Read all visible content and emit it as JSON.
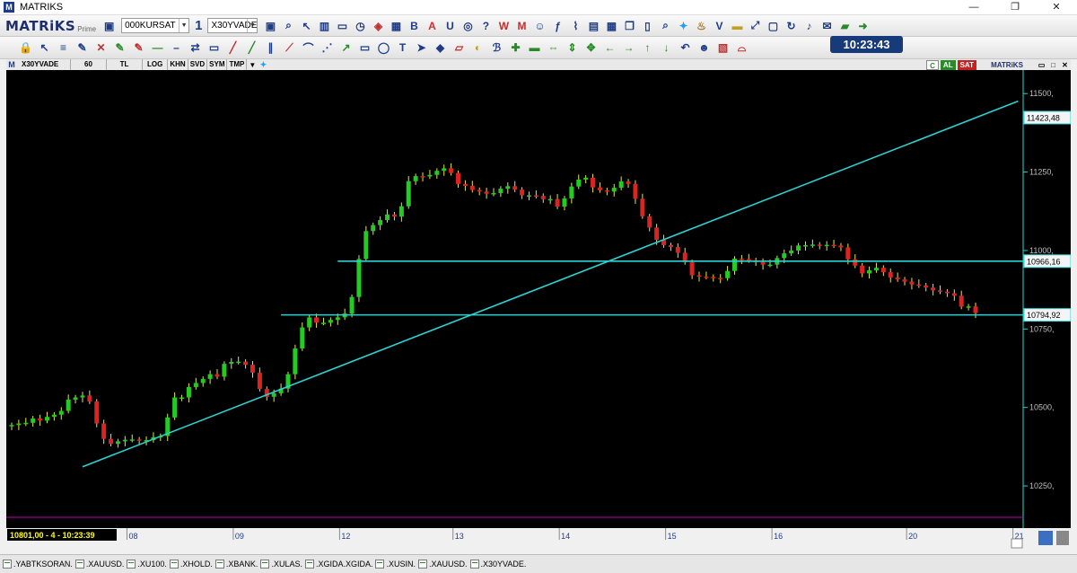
{
  "window": {
    "title": "MATRIKS",
    "minimize": "—",
    "maximize": "❐",
    "close": "✕"
  },
  "toolbar1": {
    "logo": "MATRiKS",
    "logo_sub": "Prime",
    "account_combo": "000KURSAT",
    "layout_number": "1",
    "symbol_combo": "X30YVADE",
    "icons": [
      "save-icon",
      "search-icon",
      "pointer-icon",
      "bar-chart-icon",
      "monitor-icon",
      "clock-icon",
      "layers-icon",
      "table-icon",
      "bold-b-icon",
      "font-color-a-icon",
      "underline-u-icon",
      "circle-tool-icon",
      "help-icon",
      "wp-icon",
      "m-icon",
      "people-icon",
      "fx-icon",
      "chart-line-icon",
      "grid-icon",
      "calendar-icon",
      "copy-icon",
      "doc-icon",
      "magnify-icon",
      "twitter-icon",
      "cup-icon",
      "v-icon",
      "folder-icon",
      "resize-icon",
      "window-icon",
      "refresh-icon",
      "bell-icon",
      "mail-icon",
      "chat-icon",
      "green-arrow-icon"
    ]
  },
  "clock": "10:23:43",
  "toolbar2": {
    "icons": [
      "lock-icon",
      "arrow-up-left-icon",
      "fibonacci-icon",
      "pencil-icon",
      "cross-icon",
      "pencil-green-icon",
      "pencil-red-icon",
      "minus-icon",
      "dash-icon",
      "arrows-lr-icon",
      "visual-icon",
      "pen-red-icon",
      "pen-green-icon",
      "channel-icon",
      "gann-icon",
      "arc-icon",
      "fan-icon",
      "trend-icon",
      "rect-icon",
      "ellipse-icon",
      "text-icon",
      "arrow-icon",
      "shapes-icon",
      "eraser-icon",
      "fill-icon",
      "brush-icon",
      "zoom-in-icon",
      "zoom-out-icon",
      "move-h-icon",
      "move-v-icon",
      "fit-icon",
      "left-arrow-icon",
      "right-arrow-icon",
      "up-arrow-icon",
      "down-arrow-icon",
      "undo-icon",
      "person-icon",
      "image-icon",
      "red-arc-icon"
    ]
  },
  "chart_header": {
    "symbol": "X30YVADE",
    "period": "60",
    "currency": "TL",
    "log": "LOG",
    "khn": "KHN",
    "svd": "SVD",
    "sym": "SYM",
    "tmp": "TMP",
    "c_tag": "C",
    "al_tag": "AL",
    "sat_tag": "SAT",
    "brand": "MATRiKS"
  },
  "status_readout": "10801,00 - 4 - 10:23:39",
  "chart_data": {
    "type": "candlestick",
    "title": "",
    "xlabel": "",
    "ylabel": "",
    "ylim": [
      10150,
      11575
    ],
    "y_ticks": [
      "11500,",
      "11250,",
      "11000,",
      "10750,",
      "10500,",
      "10250,"
    ],
    "y_tick_values": [
      11500,
      11250,
      11000,
      10750,
      10500,
      10250
    ],
    "x_ticks": [
      "08",
      "09",
      "12",
      "13",
      "14",
      "15",
      "16",
      "20",
      "21"
    ],
    "price_labels": [
      {
        "text": "11423,48",
        "value": 11423.48
      },
      {
        "text": "10966,16",
        "value": 10966.16
      },
      {
        "text": "10794,92",
        "value": 10794.92
      }
    ],
    "trend_line": {
      "from": {
        "bar": 10,
        "value": 10311
      },
      "to": {
        "bar": 142,
        "value": 11476
      }
    },
    "horizontal_lines": [
      {
        "value": 10794.92,
        "from_bar": 38
      },
      {
        "value": 10966.16,
        "from_bar": 46
      }
    ],
    "up_color": "#22cc22",
    "down_color": "#dd2222",
    "grid": false,
    "background": "#000000",
    "series_close": [
      10444,
      10449,
      10451,
      10465,
      10458,
      10470,
      10477,
      10489,
      10525,
      10532,
      10538,
      10519,
      10449,
      10400,
      10384,
      10392,
      10397,
      10398,
      10395,
      10396,
      10405,
      10409,
      10468,
      10532,
      10532,
      10565,
      10578,
      10591,
      10606,
      10598,
      10639,
      10645,
      10646,
      10636,
      10611,
      10559,
      10534,
      10545,
      10560,
      10606,
      10688,
      10755,
      10787,
      10770,
      10770,
      10779,
      10787,
      10799,
      10852,
      10973,
      11062,
      11081,
      11097,
      11115,
      11108,
      11141,
      11221,
      11237,
      11236,
      11241,
      11254,
      11262,
      11247,
      11212,
      11206,
      11193,
      11188,
      11181,
      11183,
      11197,
      11205,
      11194,
      11176,
      11176,
      11174,
      11164,
      11164,
      11140,
      11166,
      11204,
      11226,
      11232,
      11201,
      11192,
      11188,
      11200,
      11220,
      11212,
      11165,
      11109,
      11073,
      11034,
      11017,
      11011,
      10993,
      10963,
      10921,
      10917,
      10916,
      10913,
      10912,
      10935,
      10974,
      10973,
      10969,
      10963,
      10955,
      10955,
      10976,
      10991,
      11000,
      11016,
      11017,
      11019,
      11016,
      11018,
      11016,
      11010,
      10972,
      10952,
      10927,
      10937,
      10945,
      10931,
      10914,
      10908,
      10901,
      10892,
      10889,
      10882,
      10873,
      10869,
      10864,
      10856,
      10821,
      10822,
      10801
    ]
  },
  "bottom_tabs": [
    ".YABTKSORAN.",
    ".XAUUSD.",
    ".XU100.",
    ".XHOLD.",
    ".XBANK.",
    ".XULAS.",
    ".XGIDA.XGIDA.",
    ".XUSIN.",
    ".XAUUSD.",
    ".X30YVADE."
  ]
}
